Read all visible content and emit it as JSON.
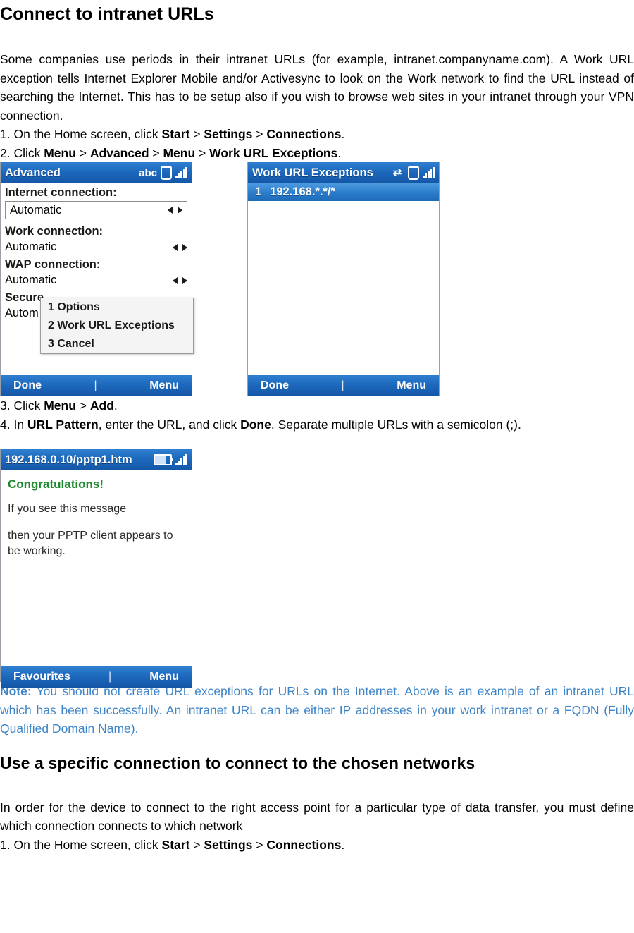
{
  "doc": {
    "title": "Connect to intranet URLs",
    "intro": "Some companies use periods in their intranet URLs (for example, intranet.companyname.com). A Work URL exception tells Internet Explorer Mobile and/or Activesync to look on the Work network to find the URL instead of searching the Internet. This has to be setup also if you wish to browse web sites in your intranet through your VPN connection.",
    "step1_prefix": "1. On the Home screen, click ",
    "step1_a": "Start",
    "sep_gt": " > ",
    "step1_b": "Settings",
    "step1_c": "Connections",
    "step1_suffix": ".",
    "step2_prefix": "2. Click ",
    "step2_a": "Menu",
    "step2_b": "Advanced",
    "step2_c": "Menu",
    "step2_d": "Work URL Exceptions",
    "step2_suffix": ".",
    "step3_prefix": "3. Click ",
    "step3_a": "Menu",
    "step3_b": "Add",
    "step3_suffix": ".",
    "step4_prefix": "4. In ",
    "step4_a": "URL Pattern",
    "step4_mid": ", enter the URL, and click ",
    "step4_b": "Done",
    "step4_suffix": ". Separate multiple URLs with a semicolon (;).",
    "note_label": "Note:",
    "note_text": " You should not create URL exceptions for URLs on the Internet. Above is an example of an intranet URL which has been successfully. An intranet URL can be either IP addresses in your work intranet or a FQDN (Fully Qualified Domain Name).",
    "h2": "Use a specific connection to connect to the chosen networks",
    "para2": "In order for the device to connect to the right access point for a particular type of data transfer, you must define which connection connects to which network",
    "last_step_prefix": "1. On the Home screen, click ",
    "last_step_a": "Start",
    "last_step_b": "Settings",
    "last_step_c": "Connections",
    "last_step_suffix": "."
  },
  "shot_advanced": {
    "title": "Advanced",
    "status_abc": "abc",
    "signal_icon": "signal-bars-icon",
    "phone_icon": "phone-icon",
    "internet_label": "Internet connection:",
    "internet_value": "Automatic",
    "work_label": "Work connection:",
    "work_value": "Automatic",
    "wap_label": "WAP connection:",
    "wap_value": "Automatic",
    "secure_label": "Secure",
    "secure_value": "Autom",
    "menu": [
      "1 Options",
      "2 Work URL Exceptions",
      "3 Cancel"
    ],
    "softkey_left": "Done",
    "softkey_sep": "|",
    "softkey_right": "Menu"
  },
  "shot_exceptions": {
    "title": "Work URL Exceptions",
    "row_index": "1",
    "row_value": "192.168.*.*/*",
    "softkey_left": "Done",
    "softkey_sep": "|",
    "softkey_right": "Menu"
  },
  "shot_browser": {
    "title": "192.168.0.10/pptp1.htm",
    "congrats": "Congratulations!",
    "line1": "If you see this message",
    "line2": "then your PPTP client appears to be working.",
    "softkey_left": "Favourites",
    "softkey_sep": "|",
    "softkey_right": "Menu"
  },
  "colors": {
    "note_blue": "#3d85c8",
    "titlebar_blue": "#1d69bd",
    "select_blue": "#2a7ccb",
    "congrats_green": "#1f8a2f"
  }
}
